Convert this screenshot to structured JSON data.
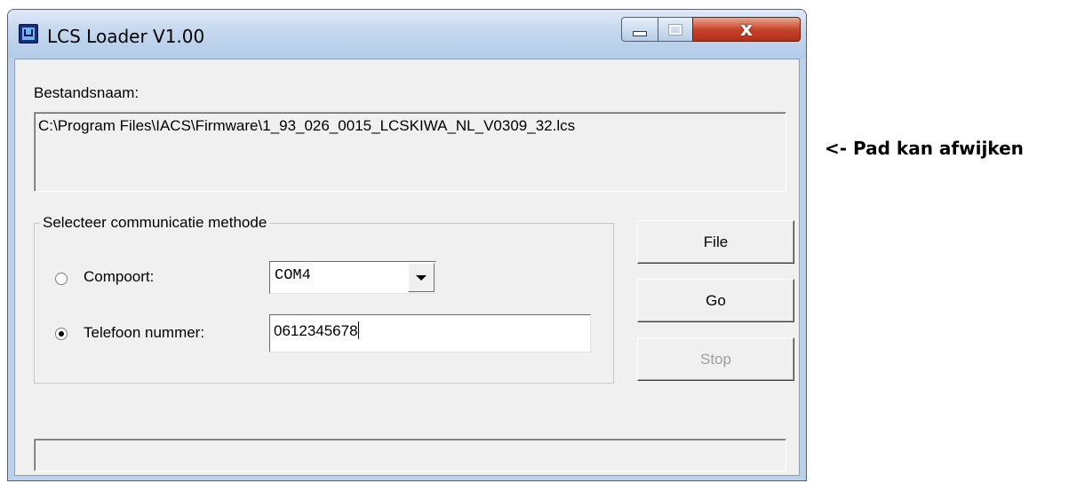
{
  "window": {
    "title": "LCS Loader V1.00",
    "icon": "app-logo-icon",
    "controls": {
      "minimize": "minimize-icon",
      "maximize": "maximize-icon",
      "close_symbol": "x"
    }
  },
  "file": {
    "label": "Bestandsnaam:",
    "path": "C:\\Program Files\\IACS\\Firmware\\1_93_026_0015_LCSKIWA_NL_V0309_32.lcs"
  },
  "comm": {
    "group_label": "Selecteer communicatie methode",
    "port": {
      "label": "Compoort:",
      "selected": false,
      "value": "COM4"
    },
    "phone": {
      "label": "Telefoon nummer:",
      "selected": true,
      "value": "0612345678"
    }
  },
  "buttons": {
    "file": "File",
    "go": "Go",
    "stop": "Stop"
  },
  "annotation": "<- Pad kan afwijken",
  "colors": {
    "titlebar": "#c4d7ee",
    "close_button": "#c8452d",
    "face": "#f0f0f0",
    "disabled_text": "#a0a0a0"
  }
}
